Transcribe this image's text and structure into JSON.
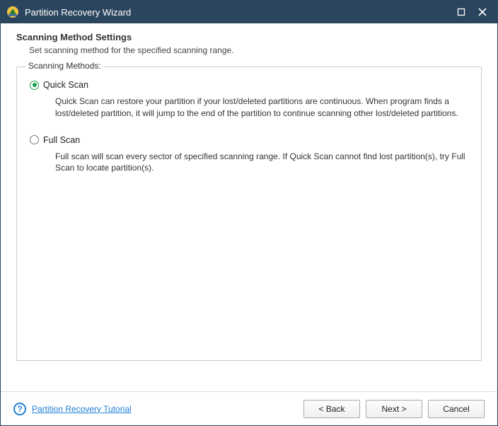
{
  "window": {
    "title": "Partition Recovery Wizard"
  },
  "header": {
    "title": "Scanning Method Settings",
    "subtitle": "Set scanning method for the specified scanning range."
  },
  "groupbox": {
    "legend": "Scanning Methods:",
    "options": [
      {
        "label": "Quick Scan",
        "selected": true,
        "description": "Quick Scan can restore your partition if your lost/deleted partitions are continuous. When program finds a lost/deleted partition, it will jump to the end of the partition to continue scanning other lost/deleted partitions."
      },
      {
        "label": "Full Scan",
        "selected": false,
        "description": "Full scan will scan every sector of specified scanning range. If Quick Scan cannot find lost partition(s), try Full Scan to locate partition(s)."
      }
    ]
  },
  "footer": {
    "tutorial_link": "Partition Recovery Tutorial",
    "back": "< Back",
    "next": "Next >",
    "cancel": "Cancel",
    "help_glyph": "?"
  }
}
